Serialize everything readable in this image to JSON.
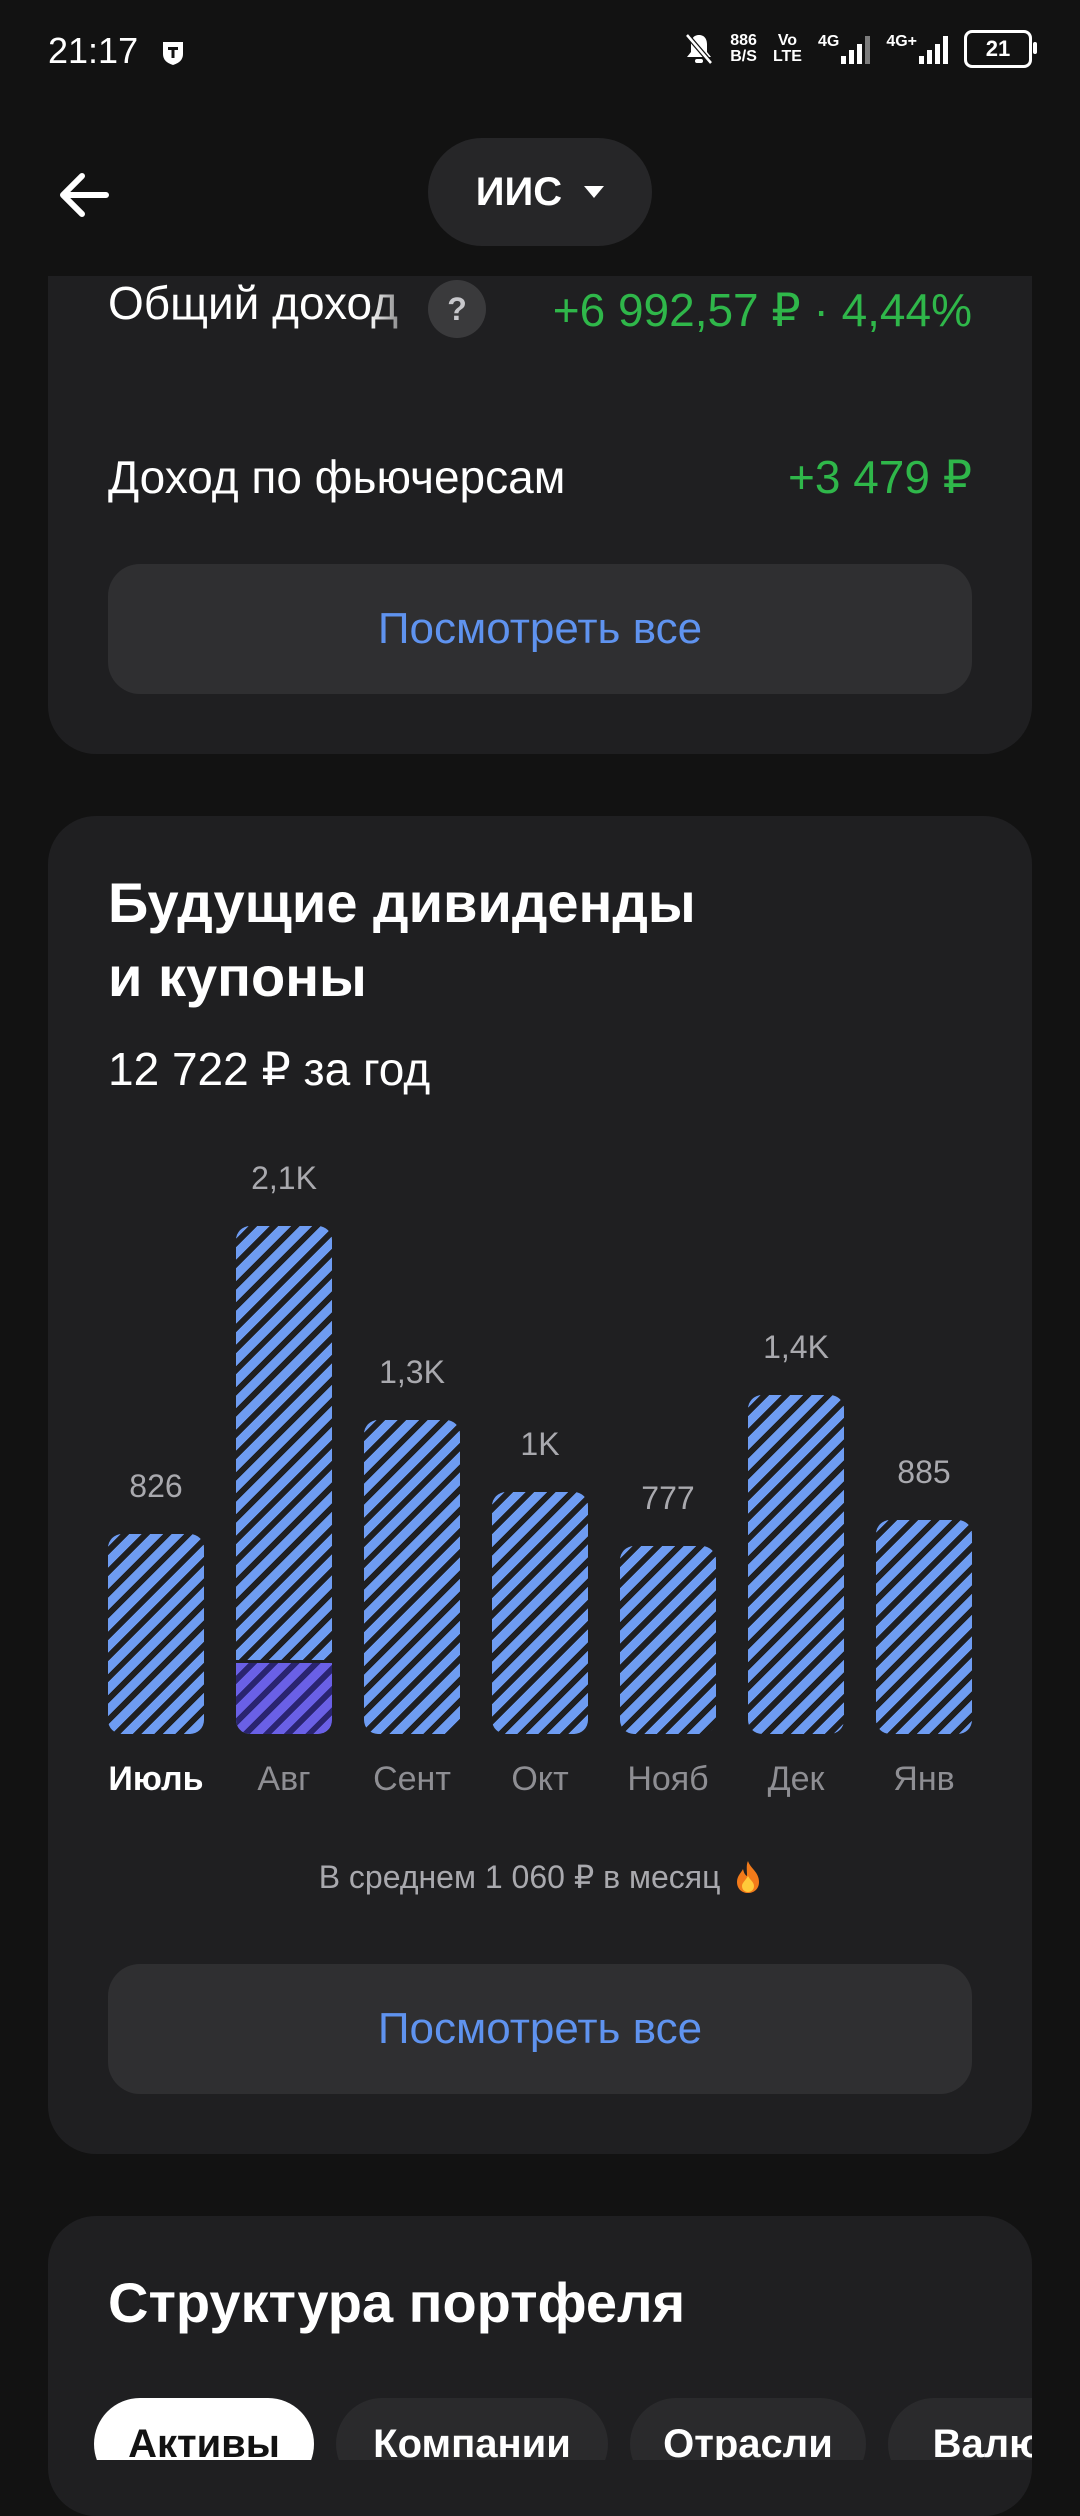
{
  "status_bar": {
    "time": "21:17",
    "net_speed_value": "886",
    "net_speed_unit": "B/S",
    "volte_top": "Vo",
    "volte_bottom": "LTE",
    "sig1_label": "4G",
    "sig2_label": "4G+",
    "battery": "21"
  },
  "header": {
    "back_icon": "arrow-left-icon",
    "account_selector": "ИИС",
    "account_caret_icon": "caret-down-icon"
  },
  "income_card": {
    "total_label": "Общий доход",
    "total_help": "?",
    "total_value": "+6 992,57 ₽ · 4,44%",
    "futures_label": "Доход по фьючерсам",
    "futures_value": "+3 479 ₽",
    "view_all": "Посмотреть все",
    "positive_color": "#2fb74a"
  },
  "dividends_card": {
    "title_line1": "Будущие дивиденды",
    "title_line2": "и купоны",
    "yearly_total": "12 722 ₽ за год",
    "average_text": "В среднем 1 060 ₽ в месяц",
    "average_icon": "fire-icon",
    "view_all": "Посмотреть все",
    "bar_color": "#6e9cf2",
    "coupon_color": "#6a60e6"
  },
  "chart_data": {
    "type": "bar",
    "categories": [
      "Июль",
      "Авг",
      "Сент",
      "Окт",
      "Нояб",
      "Дек",
      "Янв"
    ],
    "values": [
      826,
      2100,
      1300,
      1000,
      777,
      1400,
      885
    ],
    "data_labels": [
      "826",
      "2,1K",
      "1,3K",
      "1K",
      "777",
      "1,4K",
      "885"
    ],
    "coupon_share": [
      0,
      0.14,
      0,
      0,
      0,
      0,
      0
    ],
    "active_category": "Июль",
    "ylim": [
      0,
      2100
    ]
  },
  "structure_card": {
    "title": "Структура портфеля",
    "tabs": [
      {
        "label": "Активы",
        "active": true
      },
      {
        "label": "Компании",
        "active": false
      },
      {
        "label": "Отрасли",
        "active": false
      },
      {
        "label": "Валю",
        "active": false
      }
    ]
  }
}
